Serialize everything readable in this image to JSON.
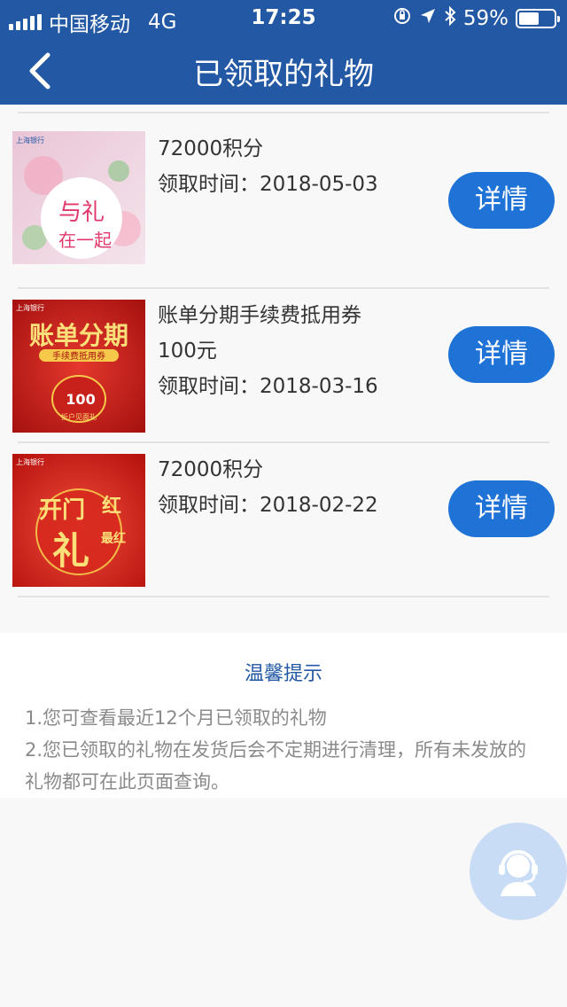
{
  "status_bar": {
    "carrier": "中国移动",
    "network": "4G",
    "time": "17:25",
    "battery": "59%",
    "battery_level": 0.59,
    "icons": [
      "signal-icon",
      "orientation-lock-icon",
      "location-icon",
      "bluetooth-icon",
      "battery-icon"
    ]
  },
  "nav": {
    "title": "已领取的礼物",
    "back_icon": "chevron-left-icon"
  },
  "gifts": [
    {
      "lines": [
        "72000积分",
        "领取时间：2018-05-03"
      ],
      "detail_label": "详情",
      "thumb_bank": "上海银行",
      "thumb_text1": "与礼",
      "thumb_text2": "在一起"
    },
    {
      "lines": [
        "账单分期手续费抵用券",
        "100元",
        "领取时间：2018-03-16"
      ],
      "detail_label": "详情",
      "thumb_bank": "上海银行",
      "thumb_text1": "账单分期",
      "thumb_text2": "手续费抵用券",
      "thumb_text3": "100",
      "thumb_text4": "折户见面礼"
    },
    {
      "lines": [
        "72000积分",
        "领取时间：2018-02-22"
      ],
      "detail_label": "详情",
      "thumb_bank": "上海银行",
      "thumb_text1": "开门",
      "thumb_text2": "红",
      "thumb_text3": "礼",
      "thumb_text4": "最红"
    }
  ],
  "tips": {
    "title": "温馨提示",
    "line1": "1.您可查看最近12个月已领取的礼物",
    "line2": "2.您已领取的礼物在发货后会不定期进行清理，所有未发放的礼物都可在此页面查询。"
  },
  "colors": {
    "brand": "#2358a4",
    "button": "#1f73d6",
    "service": "#c9dcf6"
  }
}
